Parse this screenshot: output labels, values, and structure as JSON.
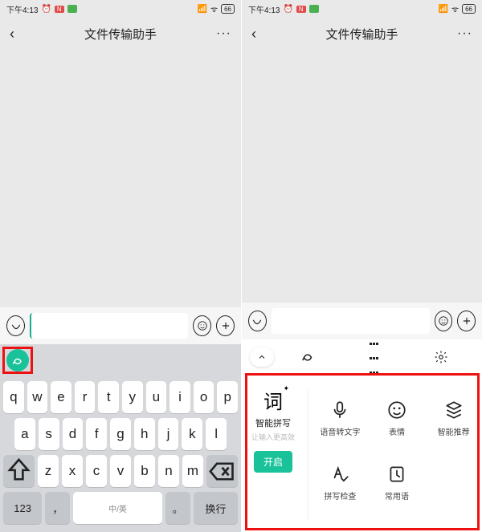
{
  "status": {
    "time": "下午4:13",
    "alarm": "⏰",
    "badge1": "N",
    "battery": "66"
  },
  "nav": {
    "title": "文件传输助手",
    "more": "···"
  },
  "input": {
    "placeholder": "",
    "voice_icon": "voice-icon",
    "smile_icon": "smile-icon",
    "plus_icon": "plus-icon"
  },
  "keyboard": {
    "row1": [
      "q",
      "w",
      "e",
      "r",
      "t",
      "y",
      "u",
      "i",
      "o",
      "p"
    ],
    "row2": [
      "a",
      "s",
      "d",
      "f",
      "g",
      "h",
      "j",
      "k",
      "l"
    ],
    "row3": [
      "z",
      "x",
      "c",
      "v",
      "b",
      "n",
      "m"
    ],
    "fn": {
      "num": "123",
      "comma": "，",
      "lang": "中/英",
      "space": "",
      "period": "。",
      "enter": "换行"
    }
  },
  "strip2": {
    "expand": "⌃"
  },
  "smart": {
    "title": "词",
    "sub": "智能拼写",
    "hint": "让输入更高效",
    "enable": "开启",
    "features": [
      {
        "id": "voice-to-text",
        "label": "语音转文字"
      },
      {
        "id": "emoji",
        "label": "表情"
      },
      {
        "id": "smart-rec",
        "label": "智能推荐"
      },
      {
        "id": "spell-check",
        "label": "拼写检查"
      },
      {
        "id": "phrases",
        "label": "常用语"
      }
    ]
  }
}
